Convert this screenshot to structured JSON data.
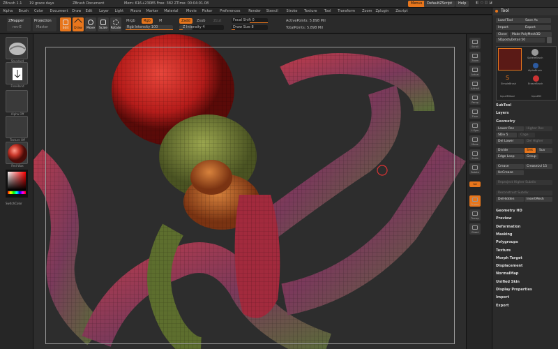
{
  "title_bar": {
    "app": "ZBrush  1.1",
    "doc_note": "19 grace days",
    "document": "ZBrush Document",
    "stats": "Mem: 616+23085  Free: 382  ZTime: 00:04:01.08"
  },
  "header_buttons": {
    "menus": "Menus",
    "default_script": "DefaultZScript",
    "help": "Help"
  },
  "menu": [
    "Alpha",
    "Brush",
    "Color",
    "Document",
    "Draw",
    "Edit",
    "Layer",
    "Light",
    "Macro",
    "Marker",
    "Material",
    "Movie",
    "Picker",
    "Preferences",
    "Render",
    "Stencil",
    "Stroke",
    "Texture",
    "Tool",
    "Transform",
    "Zoom",
    "Zplugin",
    "Zscript"
  ],
  "toolbar": {
    "zmapper": "ZMapper",
    "zmapper_sub": "rev-E",
    "projection": "Projection",
    "projection_sub": "Master",
    "edit": "Edit",
    "draw": "Draw",
    "move": "Move",
    "scale": "Scale",
    "rotate": "Rotate",
    "mrgb": "Mrgb",
    "rgb": "Rgb",
    "m": "M",
    "rgb_intensity": "Rgb Intensity 100",
    "zadd": "Zadd",
    "zsub": "Zsub",
    "zcut": "Zcut",
    "z_intensity": "Z Intensity 4",
    "focal_shift": "Focal Shift 0",
    "draw_size": "Draw Size 8",
    "active_points": "ActivePoints: 5.898 Mil",
    "total_points": "TotalPoints: 5.898 Mil"
  },
  "left_shelf": {
    "brush": "Standard",
    "stroke": "FreeHand",
    "alpha": "Alpha Off",
    "texture": "Texture Off",
    "material": "Red Wax",
    "switch": "SwitchColor"
  },
  "right_shelf": [
    "Scroll",
    "Zoom",
    "Actual",
    "AAHalf",
    "Persp",
    "Floor",
    "L.Sym",
    "Move",
    "Scale",
    "Rotate",
    "Sel",
    "Frame",
    "Transp",
    "Ghost"
  ],
  "tool_panel": {
    "title": "Tool",
    "buttons": [
      "Load Tool",
      "Save As",
      "Import",
      "Export",
      "Clone",
      "Make PolyMesh3D"
    ],
    "current_tool": "SDpostyDetail 50",
    "tools": [
      "SDpostyDetail",
      "SphereBrush",
      "AlphaBrush",
      "SimpleBrush",
      "EraserBrush",
      "Input3Dtool",
      "Input3D"
    ],
    "subtool": "SubTool",
    "layers": "Layers",
    "geometry": "Geometry",
    "geo_buttons": [
      "Lower Res",
      "Higher Res",
      "SDiv 5",
      "Cage",
      "Del Lower",
      "Del Higher",
      "Divide",
      "Smt",
      "Suv",
      "Edge Loop",
      "Group",
      "Crease",
      "CreaseLvl 15",
      "UnCrease",
      "Reproject Higher Subdiv",
      "Reconstruct Subdiv",
      "DelHidden",
      "InsertMesh"
    ],
    "sections": [
      "Geometry HD",
      "Preview",
      "Deformation",
      "Masking",
      "Polygroups",
      "Texture",
      "Morph Target",
      "Displacement",
      "NormalMap",
      "Unified Skin",
      "Display Properties",
      "Import",
      "Export"
    ]
  },
  "colors": {
    "accent": "#e8761c",
    "panel": "#2b2b2b",
    "viewport_bg": "#2d2d2d"
  }
}
